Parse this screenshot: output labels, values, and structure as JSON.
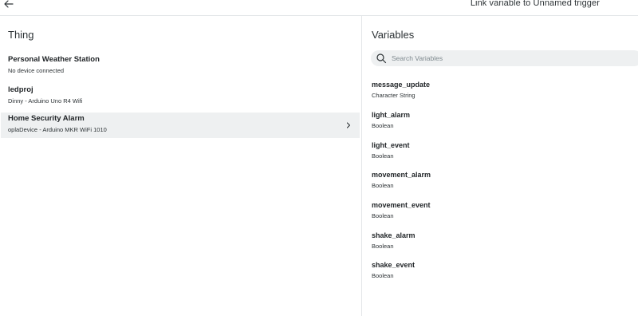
{
  "header": {
    "title": "Link variable to Unnamed trigger"
  },
  "things": {
    "heading": "Thing",
    "items": [
      {
        "name": "Personal Weather Station",
        "sub": "No device connected"
      },
      {
        "name": "ledproj",
        "sub": "Dinny - Arduino Uno R4 Wifi"
      },
      {
        "name": "Home Security Alarm",
        "sub": "oplaDevice - Arduino MKR WiFi 1010"
      }
    ]
  },
  "variables": {
    "heading": "Variables",
    "search_placeholder": "Search Variables",
    "items": [
      {
        "name": "message_update",
        "type": "Character String"
      },
      {
        "name": "light_alarm",
        "type": "Boolean"
      },
      {
        "name": "light_event",
        "type": "Boolean"
      },
      {
        "name": "movement_alarm",
        "type": "Boolean"
      },
      {
        "name": "movement_event",
        "type": "Boolean"
      },
      {
        "name": "shake_alarm",
        "type": "Boolean"
      },
      {
        "name": "shake_event",
        "type": "Boolean"
      }
    ]
  },
  "icons": {
    "back": "arrow-left-icon",
    "chevron": "chevron-right-icon",
    "search": "search-icon"
  },
  "colors": {
    "selected_row": "#eef0f1",
    "divider": "#e3e6e8",
    "text": "#1f2326"
  }
}
